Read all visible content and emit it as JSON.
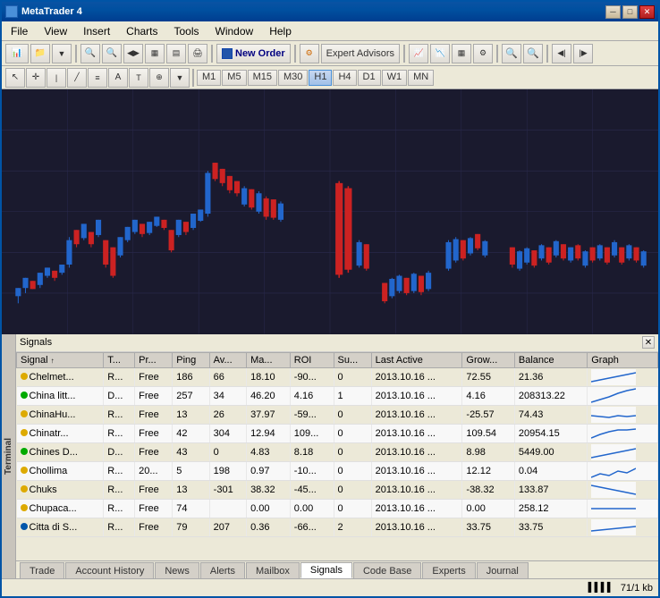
{
  "window": {
    "title": "MetaTrader 4"
  },
  "menu": {
    "items": [
      "File",
      "View",
      "Insert",
      "Charts",
      "Tools",
      "Window",
      "Help"
    ]
  },
  "toolbar": {
    "new_order_label": "New Order",
    "expert_advisors_label": "Expert Advisors"
  },
  "timeframes": {
    "items": [
      "M1",
      "M5",
      "M15",
      "M30",
      "H1",
      "H4",
      "D1",
      "W1",
      "MN"
    ],
    "active": "H1"
  },
  "signals_panel": {
    "columns": [
      "Signal",
      "T...",
      "Pr...",
      "Ping",
      "Av...",
      "Ma...",
      "ROI",
      "Su...",
      "Last Active",
      "Grow...",
      "Balance",
      "Graph"
    ],
    "rows": [
      {
        "name": "Chelmet...",
        "type": "R...",
        "price": "Free",
        "ping": "186",
        "av": "66",
        "ma": "18.10",
        "roi": "-90...",
        "su": "0",
        "last_active": "2013.10.16 ...",
        "grow": "72.55",
        "balance": "21.36",
        "dot": "yellow"
      },
      {
        "name": "China litt...",
        "type": "D...",
        "price": "Free",
        "ping": "257",
        "av": "34",
        "ma": "46.20",
        "roi": "4.16",
        "su": "1",
        "last_active": "2013.10.16 ...",
        "grow": "4.16",
        "balance": "208313.22",
        "dot": "green"
      },
      {
        "name": "ChinaHu...",
        "type": "R...",
        "price": "Free",
        "ping": "13",
        "av": "26",
        "ma": "37.97",
        "roi": "-59...",
        "su": "0",
        "last_active": "2013.10.16 ...",
        "grow": "-25.57",
        "balance": "74.43",
        "dot": "yellow"
      },
      {
        "name": "Chinatr...",
        "type": "R...",
        "price": "Free",
        "ping": "42",
        "av": "304",
        "ma": "12.94",
        "roi": "109...",
        "su": "0",
        "last_active": "2013.10.16 ...",
        "grow": "109.54",
        "balance": "20954.15",
        "dot": "yellow"
      },
      {
        "name": "Chines D...",
        "type": "D...",
        "price": "Free",
        "ping": "43",
        "av": "0",
        "ma": "4.83",
        "roi": "8.18",
        "su": "0",
        "last_active": "2013.10.16 ...",
        "grow": "8.98",
        "balance": "5449.00",
        "dot": "green"
      },
      {
        "name": "Chollima",
        "type": "R...",
        "price": "20...",
        "ping": "5",
        "av": "198",
        "ma": "0.97",
        "roi": "-10...",
        "su": "0",
        "last_active": "2013.10.16 ...",
        "grow": "12.12",
        "balance": "0.04",
        "dot": "yellow"
      },
      {
        "name": "Chuks",
        "type": "R...",
        "price": "Free",
        "ping": "13",
        "av": "-301",
        "ma": "38.32",
        "roi": "-45...",
        "su": "0",
        "last_active": "2013.10.16 ...",
        "grow": "-38.32",
        "balance": "133.87",
        "dot": "yellow"
      },
      {
        "name": "Chupaca...",
        "type": "R...",
        "price": "Free",
        "ping": "74",
        "av": "",
        "ma": "0.00",
        "roi": "0.00",
        "su": "0",
        "last_active": "2013.10.16 ...",
        "grow": "0.00",
        "balance": "258.12",
        "dot": "yellow"
      },
      {
        "name": "Citta di S...",
        "type": "R...",
        "price": "Free",
        "ping": "79",
        "av": "207",
        "ma": "0.36",
        "roi": "-66...",
        "su": "2",
        "last_active": "2013.10.16 ...",
        "grow": "33.75",
        "balance": "33.75",
        "dot": "blue"
      }
    ]
  },
  "tabs": {
    "items": [
      "Trade",
      "Account History",
      "News",
      "Alerts",
      "Mailbox",
      "Signals",
      "Code Base",
      "Experts",
      "Journal"
    ],
    "active": "Signals"
  },
  "status_bar": {
    "connection": "71/1 kb"
  }
}
